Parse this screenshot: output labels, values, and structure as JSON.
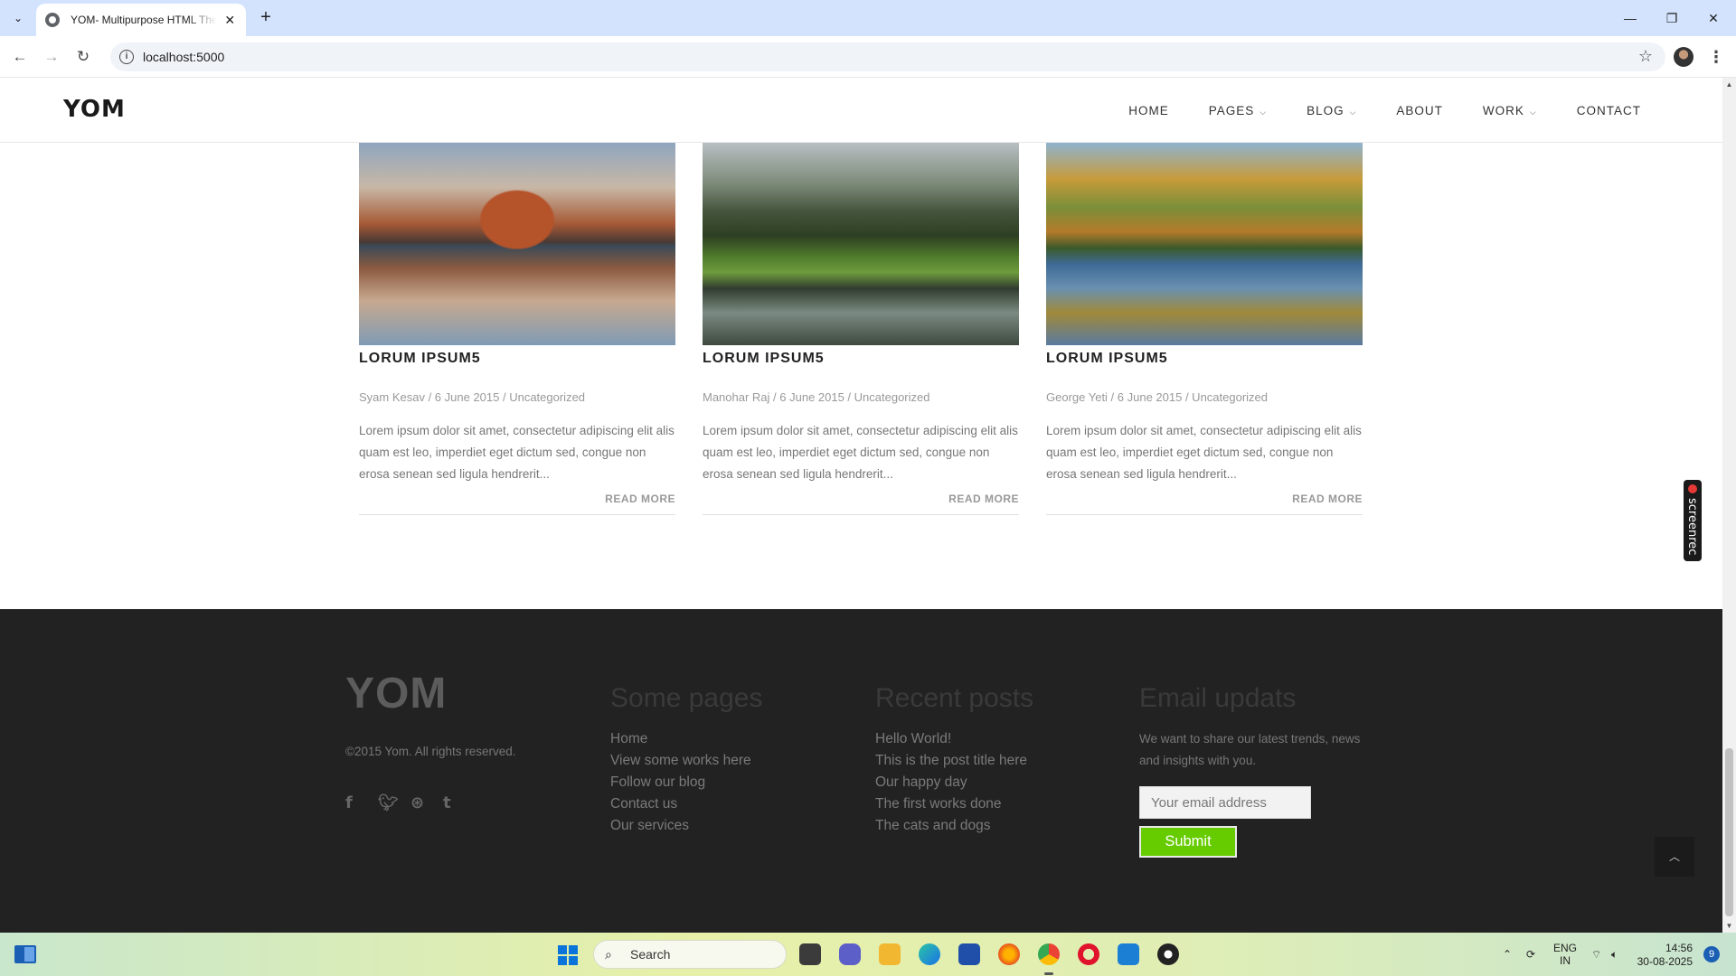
{
  "browser": {
    "tab_title": "YOM- Multipurpose HTML Theme",
    "url": "localhost:5000"
  },
  "site": {
    "logo": "YOM",
    "nav": [
      {
        "label": "HOME",
        "has_dropdown": false
      },
      {
        "label": "PAGES",
        "has_dropdown": true
      },
      {
        "label": "BLOG",
        "has_dropdown": true
      },
      {
        "label": "ABOUT",
        "has_dropdown": false
      },
      {
        "label": "WORK",
        "has_dropdown": true
      },
      {
        "label": "CONTACT",
        "has_dropdown": false
      }
    ]
  },
  "posts": [
    {
      "image": "mountain-lake-reflection",
      "title": "LORUM IPSUM5",
      "meta": "Syam Kesav / 6 June 2015 / Uncategorized",
      "excerpt": "Lorem ipsum dolor sit amet, consectetur adipiscing elit alis quam est leo, imperdiet eget dictum sed, congue non erosa senean sed ligula hendrerit...",
      "read_more": "READ MORE"
    },
    {
      "image": "forest-meadow-reflection",
      "title": "LORUM IPSUM5",
      "meta": "Manohar Raj / 6 June 2015 / Uncategorized",
      "excerpt": "Lorem ipsum dolor sit amet, consectetur adipiscing elit alis quam est leo, imperdiet eget dictum sed, congue non erosa senean sed ligula hendrerit...",
      "read_more": "READ MORE"
    },
    {
      "image": "autumn-lake-reflection",
      "title": "LORUM IPSUM5",
      "meta": "George Yeti / 6 June 2015 / Uncategorized",
      "excerpt": "Lorem ipsum dolor sit amet, consectetur adipiscing elit alis quam est leo, imperdiet eget dictum sed, congue non erosa senean sed ligula hendrerit...",
      "read_more": "READ MORE"
    }
  ],
  "footer": {
    "logo": "YOM",
    "copyright": "©2015 Yom. All rights reserved.",
    "socials": [
      "facebook-icon",
      "twitter-icon",
      "dribbble-icon",
      "tumblr-icon"
    ],
    "pages": {
      "heading": "Some pages",
      "links": [
        "Home",
        "View some works here",
        "Follow our blog",
        "Contact us",
        "Our services"
      ]
    },
    "recent": {
      "heading": "Recent posts",
      "links": [
        "Hello World!",
        "This is the post title here",
        "Our happy day",
        "The first works done",
        "The cats and dogs"
      ]
    },
    "email": {
      "heading": "Email updats",
      "text": "We want to share our latest trends, news and insights with you.",
      "placeholder": "Your email address",
      "submit": "Submit"
    }
  },
  "widget": {
    "screenrec_label": "screenrec"
  },
  "taskbar": {
    "search_label": "Search",
    "lang_top": "ENG",
    "lang_bottom": "IN",
    "time": "14:56",
    "date": "30-08-2025",
    "notification_count": "9"
  },
  "colors": {
    "accent_green": "#66cc00",
    "footer_bg": "#222222"
  }
}
